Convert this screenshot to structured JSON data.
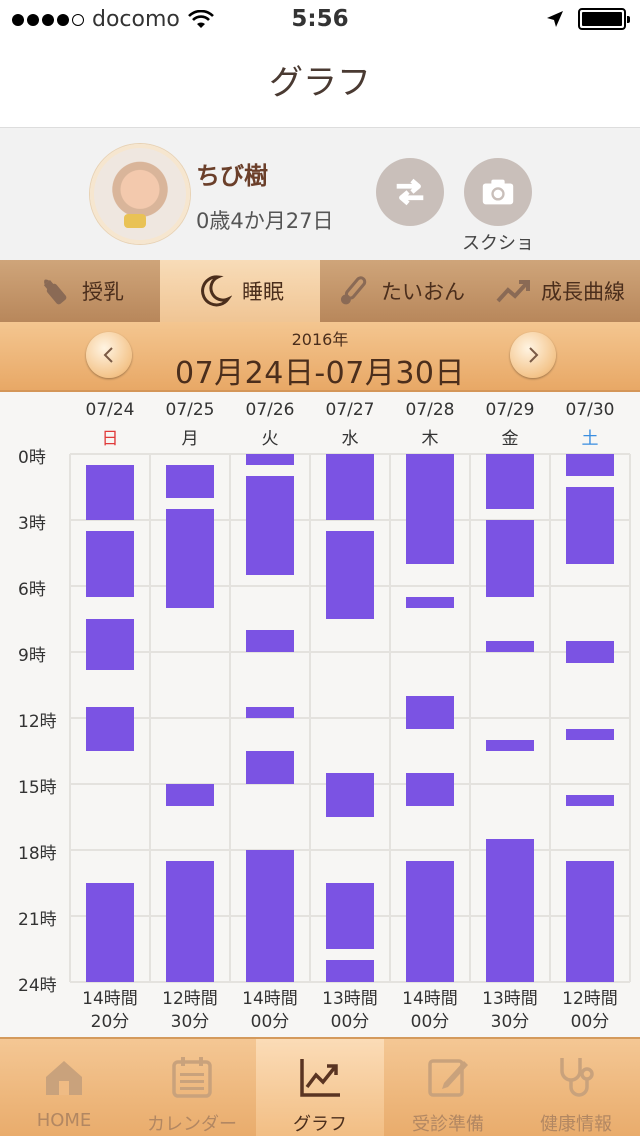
{
  "status": {
    "carrier": "docomo",
    "time": "5:56"
  },
  "nav": {
    "title": "グラフ"
  },
  "profile": {
    "name": "ちび樹",
    "age": "0歳4か月27日",
    "screenshot_label": "スクショ"
  },
  "tabs": [
    {
      "label": "授乳",
      "icon": "bottle-icon"
    },
    {
      "label": "睡眠",
      "icon": "moon-icon",
      "active": true
    },
    {
      "label": "たいおん",
      "icon": "thermometer-icon"
    },
    {
      "label": "成長曲線",
      "icon": "growth-chart-icon"
    }
  ],
  "period": {
    "year": "2016年",
    "range": "07月24日-07月30日"
  },
  "colors": {
    "sleep_bar": "#7b53e3",
    "sunday": "#e03a3a",
    "saturday": "#3a8ee0"
  },
  "chart_data": {
    "type": "bar",
    "y_axis": {
      "labels": [
        "0時",
        "3時",
        "6時",
        "9時",
        "12時",
        "15時",
        "18時",
        "21時",
        "24時"
      ],
      "range": [
        0,
        24
      ],
      "unit": "hour"
    },
    "grid": true,
    "days": [
      {
        "date": "07/24",
        "weekday": "日",
        "total": [
          "14時間",
          "20分"
        ],
        "sleep": [
          [
            0.5,
            3.0
          ],
          [
            3.5,
            6.5
          ],
          [
            7.5,
            9.8
          ],
          [
            11.5,
            13.5
          ],
          [
            19.5,
            24.0
          ]
        ]
      },
      {
        "date": "07/25",
        "weekday": "月",
        "total": [
          "12時間",
          "30分"
        ],
        "sleep": [
          [
            0.5,
            2.0
          ],
          [
            2.5,
            7.0
          ],
          [
            15.0,
            16.0
          ],
          [
            18.5,
            24.0
          ]
        ]
      },
      {
        "date": "07/26",
        "weekday": "火",
        "total": [
          "14時間",
          "00分"
        ],
        "sleep": [
          [
            0.0,
            0.5
          ],
          [
            1.0,
            5.5
          ],
          [
            8.0,
            9.0
          ],
          [
            11.5,
            12.0
          ],
          [
            13.5,
            15.0
          ],
          [
            18.0,
            24.0
          ]
        ]
      },
      {
        "date": "07/27",
        "weekday": "水",
        "total": [
          "13時間",
          "00分"
        ],
        "sleep": [
          [
            0.0,
            3.0
          ],
          [
            3.5,
            7.5
          ],
          [
            14.5,
            16.5
          ],
          [
            19.5,
            22.5
          ],
          [
            23.0,
            24.0
          ]
        ]
      },
      {
        "date": "07/28",
        "weekday": "木",
        "total": [
          "14時間",
          "00分"
        ],
        "sleep": [
          [
            0.0,
            5.0
          ],
          [
            6.5,
            7.0
          ],
          [
            11.0,
            12.5
          ],
          [
            14.5,
            16.0
          ],
          [
            18.5,
            24.0
          ]
        ]
      },
      {
        "date": "07/29",
        "weekday": "金",
        "total": [
          "13時間",
          "30分"
        ],
        "sleep": [
          [
            0.0,
            2.5
          ],
          [
            3.0,
            6.5
          ],
          [
            8.5,
            9.0
          ],
          [
            13.0,
            13.5
          ],
          [
            17.5,
            24.0
          ]
        ]
      },
      {
        "date": "07/30",
        "weekday": "土",
        "total": [
          "12時間",
          "00分"
        ],
        "sleep": [
          [
            0.0,
            1.0
          ],
          [
            1.5,
            5.0
          ],
          [
            8.5,
            9.5
          ],
          [
            12.5,
            13.0
          ],
          [
            15.5,
            16.0
          ],
          [
            18.5,
            24.0
          ]
        ]
      }
    ]
  },
  "bottom_tabs": [
    {
      "label": "HOME",
      "icon": "home-icon"
    },
    {
      "label": "カレンダー",
      "icon": "calendar-icon"
    },
    {
      "label": "グラフ",
      "icon": "chart-icon",
      "active": true
    },
    {
      "label": "受診準備",
      "icon": "edit-icon"
    },
    {
      "label": "健康情報",
      "icon": "stethoscope-icon"
    }
  ]
}
